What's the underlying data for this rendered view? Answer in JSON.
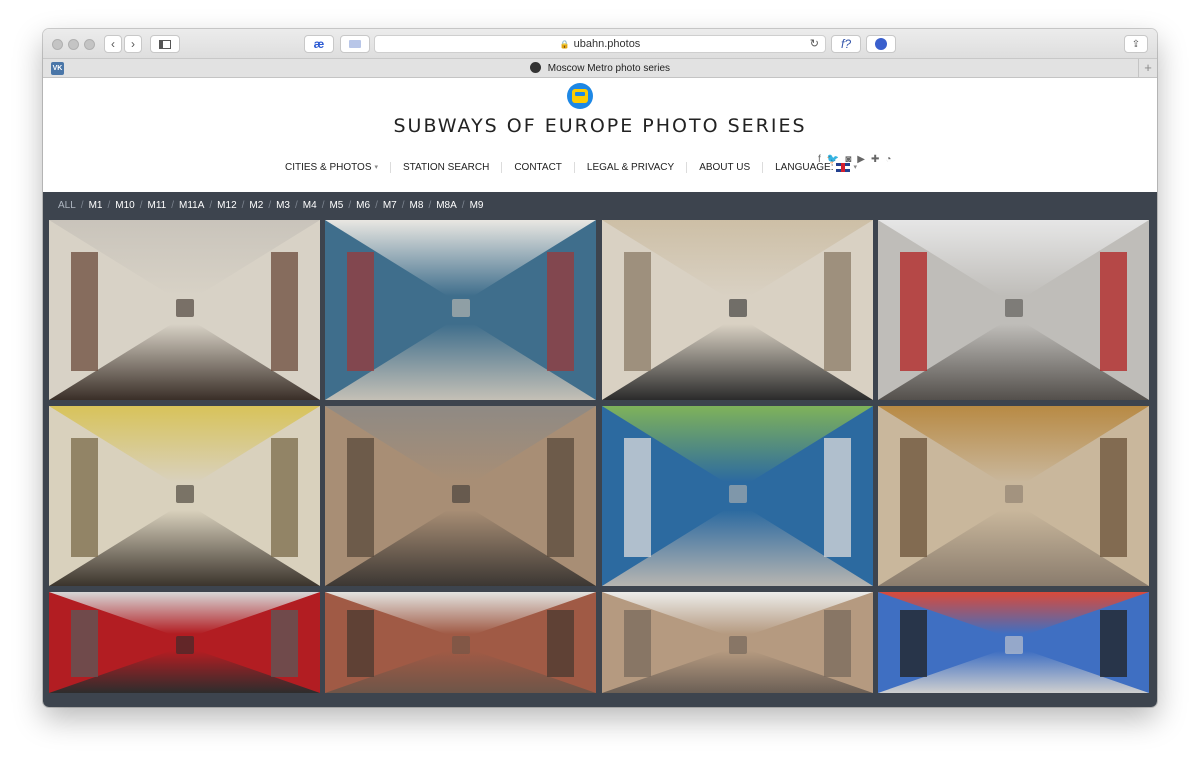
{
  "browser": {
    "address": "ubahn.photos",
    "tab_title": "Moscow Metro photo series",
    "ae_label": "æ",
    "f_label": "f?"
  },
  "site": {
    "title": "SUBWAYS OF EUROPE PHOTO SERIES",
    "nav": [
      {
        "label": "CITIES & PHOTOS",
        "dropdown": true
      },
      {
        "label": "STATION SEARCH",
        "dropdown": false
      },
      {
        "label": "CONTACT",
        "dropdown": false
      },
      {
        "label": "LEGAL & PRIVACY",
        "dropdown": false
      },
      {
        "label": "ABOUT US",
        "dropdown": false
      },
      {
        "label": "LANGUAGE:",
        "dropdown": true,
        "flag": "uk-flag"
      }
    ],
    "social_icons": [
      "facebook-icon",
      "twitter-icon",
      "instagram-icon",
      "youtube-icon",
      "plus-icon",
      "rss-icon"
    ]
  },
  "filters": [
    "ALL",
    "M1",
    "M10",
    "M11",
    "M11A",
    "M12",
    "M2",
    "M3",
    "M4",
    "M5",
    "M6",
    "M7",
    "M8",
    "M8A",
    "M9"
  ],
  "active_filter": "ALL",
  "photos": [
    {
      "name": "photo-lenin-mosaic-hall",
      "ceiling": "#c9c4bb",
      "floor": "#3a2f28",
      "wall": "#d8d2c6",
      "accent": "#6b4a3a"
    },
    {
      "name": "photo-arched-blue-hall",
      "ceiling": "#e9e7e2",
      "floor": "#c4c0b6",
      "wall": "#3f6e8c",
      "accent": "#9a3b3b"
    },
    {
      "name": "photo-coffered-ceiling-hall",
      "ceiling": "#cdbfa6",
      "floor": "#2b2b2b",
      "wall": "#d9d1c3",
      "accent": "#8a7a66"
    },
    {
      "name": "photo-white-tube-hall",
      "ceiling": "#e6e6e6",
      "floor": "#54504c",
      "wall": "#bfbdb9",
      "accent": "#b22222"
    },
    {
      "name": "photo-yellow-baroque-hall",
      "ceiling": "#d8c35a",
      "floor": "#3b342c",
      "wall": "#d9d1bd",
      "accent": "#7a6a4a"
    },
    {
      "name": "photo-marble-wedge-hall",
      "ceiling": "#8f8a84",
      "floor": "#3c3733",
      "wall": "#a88e75",
      "accent": "#5a4a3c"
    },
    {
      "name": "photo-green-ceiling-hall",
      "ceiling": "#7fb25a",
      "floor": "#b7b5b1",
      "wall": "#2c6aa0",
      "accent": "#dcdcdc"
    },
    {
      "name": "photo-golden-diamond-hall",
      "ceiling": "#b88a44",
      "floor": "#8a7c6d",
      "wall": "#c9b79c",
      "accent": "#6a5138"
    },
    {
      "name": "photo-red-panel-hall",
      "ceiling": "#d7d7d7",
      "floor": "#2d2d2d",
      "wall": "#b21d22",
      "accent": "#5a5a5a"
    },
    {
      "name": "photo-bas-relief-hall",
      "ceiling": "#e3e3e0",
      "floor": "#6e5548",
      "wall": "#a05a45",
      "accent": "#4a3a30"
    },
    {
      "name": "photo-white-vault-hall",
      "ceiling": "#ececea",
      "floor": "#6b5f55",
      "wall": "#b59a80",
      "accent": "#7a6a5c"
    },
    {
      "name": "photo-colorful-ceiling-hall",
      "ceiling": "#d94a3a",
      "floor": "#cfcfcf",
      "wall": "#3f6fc2",
      "accent": "#222222"
    }
  ]
}
